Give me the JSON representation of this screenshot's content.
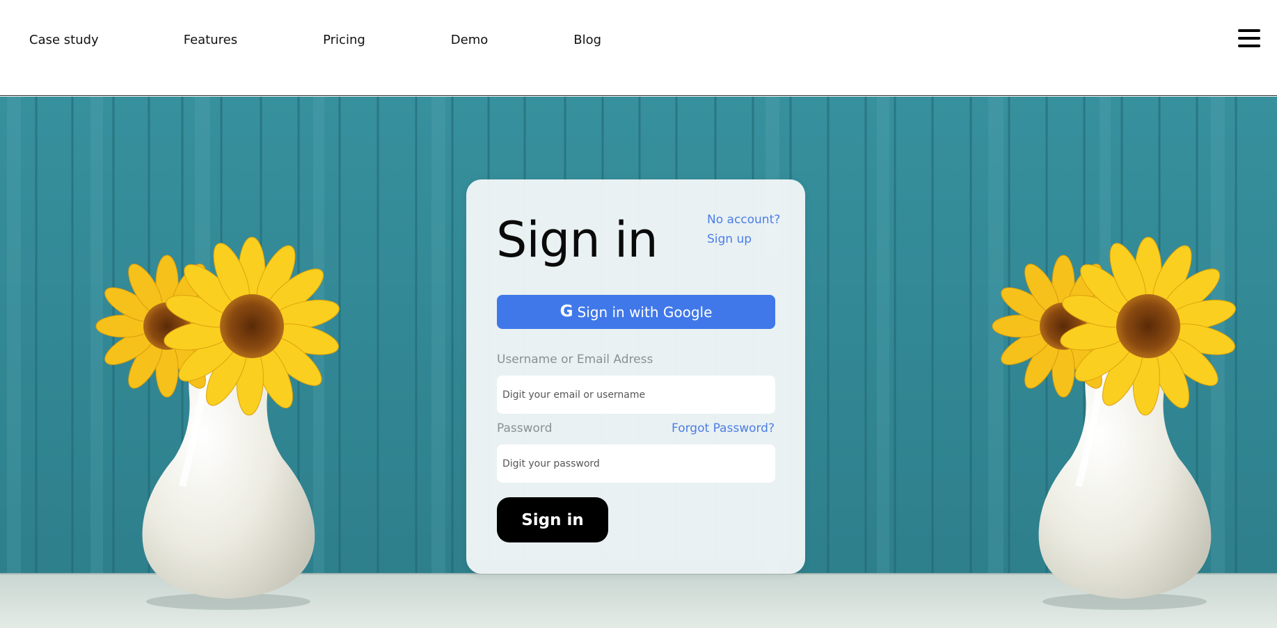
{
  "nav": {
    "items": [
      {
        "label": "Case study"
      },
      {
        "label": "Features"
      },
      {
        "label": "Pricing"
      },
      {
        "label": "Demo"
      },
      {
        "label": "Blog"
      }
    ],
    "menu_icon": "hamburger-menu-icon"
  },
  "signin": {
    "title": "Sign in",
    "no_account": "No account?",
    "signup": "Sign up",
    "google_icon": "G",
    "google_label": "Sign in with Google",
    "username_label": "Username or Email Adress",
    "username_placeholder": "Digit your email or username",
    "password_label": "Password",
    "forgot_label": "Forgot Password?",
    "password_placeholder": "Digit your password",
    "submit_label": "Sign in"
  },
  "colors": {
    "accent_blue": "#4078e9",
    "link_blue": "#4b7de6",
    "wall_teal": "#3e96a4",
    "sunflower_yellow": "#f6c11a"
  },
  "background": {
    "scene": "teal wooden wall with sunflowers in white vases"
  }
}
